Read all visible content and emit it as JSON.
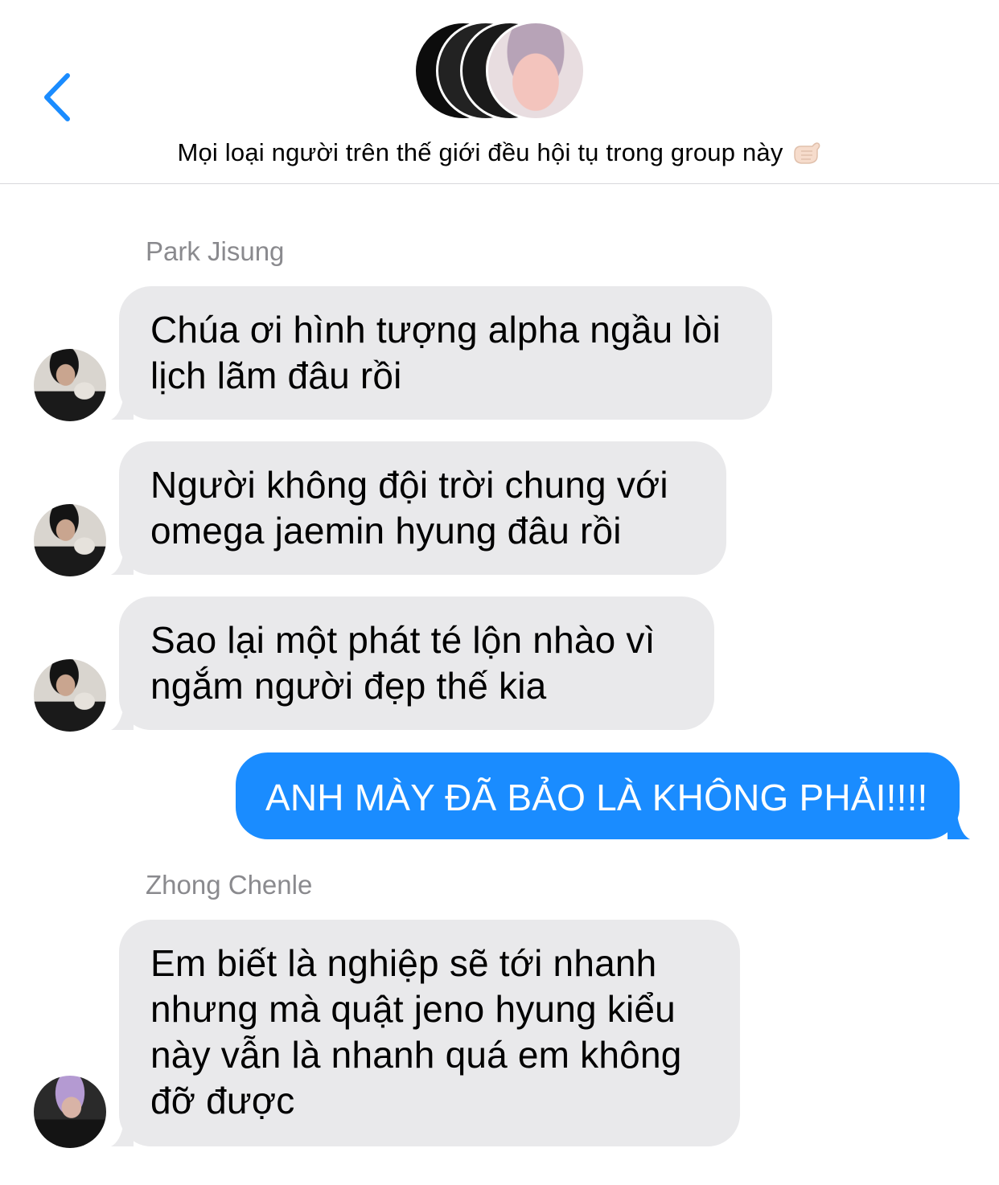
{
  "header": {
    "group_name": "Mọi loại người trên thế giới đều hội tụ trong group này",
    "back_icon": "chevron-left-icon",
    "emoji_icon": "call-me-hand-icon",
    "accent_color": "#1a8cff"
  },
  "messages": [
    {
      "sender": "Park Jisung",
      "lines": [
        "Chúa ơi hình tượng alpha ngầu lòi",
        "lịch lãm đâu rồi"
      ]
    },
    {
      "lines": [
        "Người không đội trời chung với",
        "omega jaemin hyung đâu rồi"
      ]
    },
    {
      "lines": [
        "Sao lại một phát té lộn nhào vì",
        "ngắm người đẹp thế kia"
      ]
    },
    {
      "outgoing": true,
      "lines": [
        "ANH MÀY ĐÃ BẢO LÀ KHÔNG PHẢI!!!!"
      ]
    },
    {
      "sender": "Zhong Chenle",
      "lines": [
        "Em biết là nghiệp sẽ tới nhanh",
        "nhưng mà quật jeno hyung kiểu",
        "này vẫn là nhanh quá em không",
        "đỡ được"
      ]
    }
  ],
  "colors": {
    "incoming_bubble": "#e9e9eb",
    "outgoing_bubble": "#1a8cff",
    "sender_text": "#8a8a8e"
  }
}
